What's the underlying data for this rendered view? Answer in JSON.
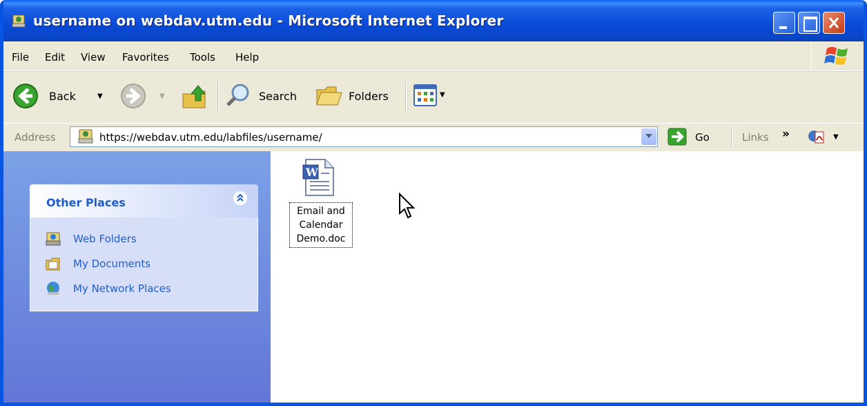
{
  "window": {
    "title": "username on webdav.utm.edu - Microsoft Internet Explorer",
    "title_color": "#ffffff",
    "titlebar_color": "#0a4ad6"
  },
  "menu": {
    "items": [
      "File",
      "Edit",
      "View",
      "Favorites",
      "Tools",
      "Help"
    ]
  },
  "toolbar": {
    "back_label": "Back",
    "search_label": "Search",
    "folders_label": "Folders"
  },
  "address": {
    "label": "Address",
    "url": "https://webdav.utm.edu/labfiles/username/",
    "go_label": "Go",
    "links_label": "Links",
    "links_chevron": "»"
  },
  "sidebar": {
    "panel_title": "Other Places",
    "panel_title_color": "#215dc6",
    "items": [
      {
        "label": "Web Folders",
        "icon": "web-folders-icon"
      },
      {
        "label": "My Documents",
        "icon": "my-documents-icon"
      },
      {
        "label": "My Network Places",
        "icon": "network-places-icon"
      }
    ]
  },
  "files": [
    {
      "name_lines": [
        "Email and",
        "Calendar",
        "Demo.doc"
      ],
      "icon": "word-document-icon"
    }
  ]
}
